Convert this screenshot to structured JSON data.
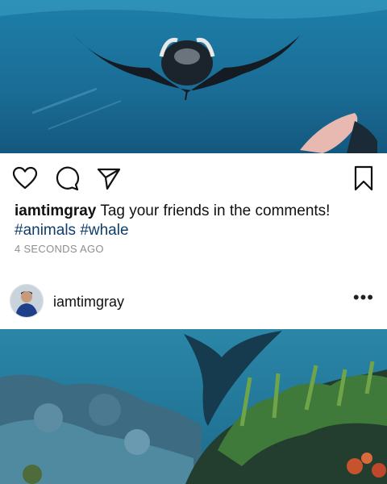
{
  "post": {
    "username": "iamtimgray",
    "caption_text": "Tag your friends in the comments!",
    "hashtags": "#animals #whale",
    "timestamp": "4 SECONDS AGO"
  },
  "next_post": {
    "username": "iamtimgray",
    "more_label": "•••"
  },
  "icons": {
    "like": "heart-icon",
    "comment": "comment-icon",
    "share": "send-icon",
    "save": "bookmark-icon"
  },
  "colors": {
    "hashtag": "#0d3e6e",
    "timestamp": "#8e8e8e",
    "ocean_top": "#1a6f98",
    "ocean_bottom": "#2f8fae"
  }
}
